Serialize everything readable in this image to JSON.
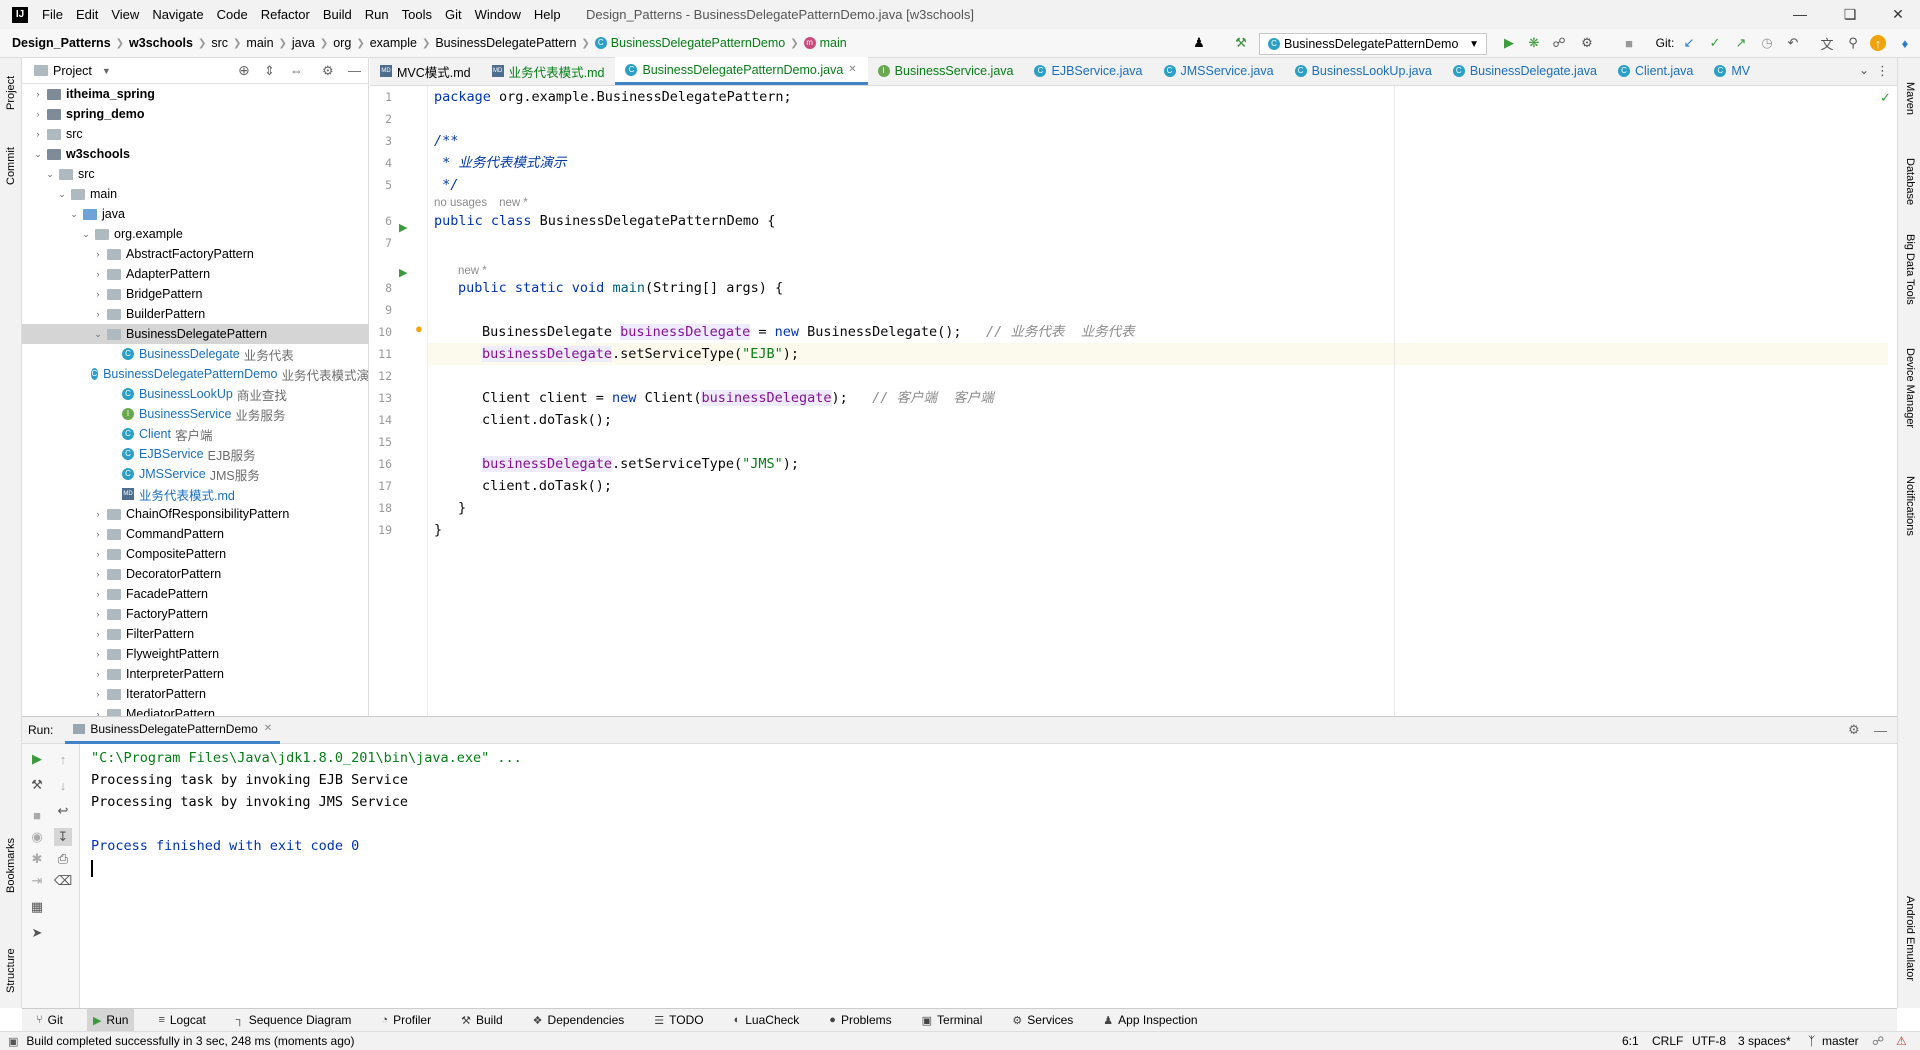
{
  "menubar": {
    "logo": "IJ",
    "items": [
      "File",
      "Edit",
      "View",
      "Navigate",
      "Code",
      "Refactor",
      "Build",
      "Run",
      "Tools",
      "Git",
      "Window",
      "Help"
    ],
    "window_title": "Design_Patterns - BusinessDelegatePatternDemo.java [w3schools]"
  },
  "breadcrumb": [
    "Design_Patterns",
    "w3schools",
    "src",
    "main",
    "java",
    "org",
    "example",
    "BusinessDelegatePattern",
    "BusinessDelegatePatternDemo",
    "main"
  ],
  "toolbar": {
    "run_config": "BusinessDelegatePatternDemo",
    "git_label": "Git:"
  },
  "project_panel": {
    "title": "Project",
    "tree": [
      {
        "label": "itheima_spring",
        "bold": true,
        "depth": 0,
        "arrow": "›",
        "icon": "folder-mod"
      },
      {
        "label": "spring_demo",
        "bold": true,
        "depth": 0,
        "arrow": "›",
        "icon": "folder-mod"
      },
      {
        "label": "src",
        "depth": 0,
        "arrow": "›",
        "icon": "folder"
      },
      {
        "label": "w3schools",
        "bold": true,
        "depth": 0,
        "arrow": "⌄",
        "icon": "folder-mod"
      },
      {
        "label": "src",
        "depth": 1,
        "arrow": "⌄",
        "icon": "folder"
      },
      {
        "label": "main",
        "depth": 2,
        "arrow": "⌄",
        "icon": "folder"
      },
      {
        "label": "java",
        "depth": 3,
        "arrow": "⌄",
        "icon": "folder-src"
      },
      {
        "label": "org.example",
        "depth": 4,
        "arrow": "⌄",
        "icon": "folder"
      },
      {
        "label": "AbstractFactoryPattern",
        "depth": 5,
        "arrow": "›",
        "icon": "folder"
      },
      {
        "label": "AdapterPattern",
        "depth": 5,
        "arrow": "›",
        "icon": "folder"
      },
      {
        "label": "BridgePattern",
        "depth": 5,
        "arrow": "›",
        "icon": "folder"
      },
      {
        "label": "BuilderPattern",
        "depth": 5,
        "arrow": "›",
        "icon": "folder"
      },
      {
        "label": "BusinessDelegatePattern",
        "depth": 5,
        "arrow": "⌄",
        "icon": "folder",
        "selected": true
      },
      {
        "label": "BusinessDelegate",
        "hint": "业务代表",
        "depth": 6,
        "icon": "class",
        "color": "blue"
      },
      {
        "label": "BusinessDelegatePatternDemo",
        "hint": "业务代表模式演",
        "depth": 6,
        "icon": "class",
        "color": "blue"
      },
      {
        "label": "BusinessLookUp",
        "hint": "商业查找",
        "depth": 6,
        "icon": "class",
        "color": "blue"
      },
      {
        "label": "BusinessService",
        "hint": "业务服务",
        "depth": 6,
        "icon": "interface",
        "color": "blue"
      },
      {
        "label": "Client",
        "hint": "客户端",
        "depth": 6,
        "icon": "class",
        "color": "blue"
      },
      {
        "label": "EJBService",
        "hint": "EJB服务",
        "depth": 6,
        "icon": "class",
        "color": "blue"
      },
      {
        "label": "JMSService",
        "hint": "JMS服务",
        "depth": 6,
        "icon": "class",
        "color": "blue"
      },
      {
        "label": "业务代表模式.md",
        "depth": 6,
        "icon": "md",
        "color": "blue"
      },
      {
        "label": "ChainOfResponsibilityPattern",
        "depth": 5,
        "arrow": "›",
        "icon": "folder"
      },
      {
        "label": "CommandPattern",
        "depth": 5,
        "arrow": "›",
        "icon": "folder"
      },
      {
        "label": "CompositePattern",
        "depth": 5,
        "arrow": "›",
        "icon": "folder"
      },
      {
        "label": "DecoratorPattern",
        "depth": 5,
        "arrow": "›",
        "icon": "folder"
      },
      {
        "label": "FacadePattern",
        "depth": 5,
        "arrow": "›",
        "icon": "folder"
      },
      {
        "label": "FactoryPattern",
        "depth": 5,
        "arrow": "›",
        "icon": "folder"
      },
      {
        "label": "FilterPattern",
        "depth": 5,
        "arrow": "›",
        "icon": "folder"
      },
      {
        "label": "FlyweightPattern",
        "depth": 5,
        "arrow": "›",
        "icon": "folder"
      },
      {
        "label": "InterpreterPattern",
        "depth": 5,
        "arrow": "›",
        "icon": "folder"
      },
      {
        "label": "IteratorPattern",
        "depth": 5,
        "arrow": "›",
        "icon": "folder"
      },
      {
        "label": "MediatorPattern",
        "depth": 5,
        "arrow": "›",
        "icon": "folder"
      }
    ]
  },
  "editor_tabs": [
    {
      "label": "MVC模式.md",
      "icon": "md"
    },
    {
      "label": "业务代表模式.md",
      "icon": "md",
      "color": "green"
    },
    {
      "label": "BusinessDelegatePatternDemo.java",
      "icon": "class",
      "active": true,
      "color": "green"
    },
    {
      "label": "BusinessService.java",
      "icon": "interface",
      "color": "green"
    },
    {
      "label": "EJBService.java",
      "icon": "class",
      "color": "blue"
    },
    {
      "label": "JMSService.java",
      "icon": "class",
      "color": "blue"
    },
    {
      "label": "BusinessLookUp.java",
      "icon": "class",
      "color": "blue"
    },
    {
      "label": "BusinessDelegate.java",
      "icon": "class",
      "color": "blue"
    },
    {
      "label": "Client.java",
      "icon": "class",
      "color": "blue"
    },
    {
      "label": "MV",
      "icon": "class",
      "color": "blue"
    }
  ],
  "code": {
    "line_numbers": [
      "1",
      "2",
      "3",
      "4",
      "5",
      "6",
      "7",
      "8",
      "9",
      "10",
      "11",
      "12",
      "13",
      "14",
      "15",
      "16",
      "17",
      "18",
      "19"
    ],
    "inlay": {
      "no_usages": "no usages",
      "new": "new *"
    },
    "package_kw": "package",
    "package_name": " org.example.BusinessDelegatePattern;",
    "doc_open": "/**",
    "doc_text": " * 业务代表模式演示",
    "doc_close": " */",
    "kw_public_class": "public class",
    "class_decl": " BusinessDelegatePatternDemo {",
    "kw_public_static_void": "public static void",
    "method_name": "main",
    "method_params": "(String[] args) {",
    "l10_type": "BusinessDelegate ",
    "l10_var": "businessDelegate",
    "l10_eq": " = ",
    "l10_new": "new",
    "l10_ctor": " BusinessDelegate();",
    "l10_cm": "// 业务代表  业务代表",
    "l11_var": "businessDelegate",
    "l11_call": ".setServiceType(",
    "l11_str": "\"EJB\"",
    "l11_end": ");",
    "l13_a": "Client client = ",
    "l13_new": "new",
    "l13_b": " Client(",
    "l13_var": "businessDelegate",
    "l13_c": ");",
    "l13_cm": "// 客户端  客户端",
    "l14": "client.doTask();",
    "l16_var": "businessDelegate",
    "l16_call": ".setServiceType(",
    "l16_str": "\"JMS\"",
    "l16_end": ");",
    "l17": "client.doTask();",
    "l18": "}",
    "l19": "}"
  },
  "run_panel": {
    "label": "Run:",
    "tab": "BusinessDelegatePatternDemo",
    "output": [
      "\"C:\\Program Files\\Java\\jdk1.8.0_201\\bin\\java.exe\" ...",
      "Processing task by invoking EJB Service",
      "Processing task by invoking JMS Service",
      "",
      "Process finished with exit code 0"
    ]
  },
  "tool_tabs": [
    {
      "label": "Git",
      "icon": "⑂"
    },
    {
      "label": "Run",
      "icon": "▶",
      "active": true
    },
    {
      "label": "Logcat",
      "icon": "≡"
    },
    {
      "label": "Sequence Diagram",
      "icon": "┐"
    },
    {
      "label": "Profiler",
      "icon": "◔"
    },
    {
      "label": "Build",
      "icon": "⚒"
    },
    {
      "label": "Dependencies",
      "icon": "❖"
    },
    {
      "label": "TODO",
      "icon": "☰"
    },
    {
      "label": "LuaCheck",
      "icon": "◐"
    },
    {
      "label": "Problems",
      "icon": "●"
    },
    {
      "label": "Terminal",
      "icon": "▣"
    },
    {
      "label": "Services",
      "icon": "⚙"
    },
    {
      "label": "App Inspection",
      "icon": "♟"
    }
  ],
  "left_stripe": [
    "Project",
    "Commit",
    "Bookmarks",
    "Structure"
  ],
  "right_stripe": [
    "Maven",
    "Database",
    "Big Data Tools",
    "Device Manager",
    "Notifications",
    "Android Emulator"
  ],
  "status": {
    "message": "Build completed successfully in 3 sec, 248 ms (moments ago)",
    "position": "6:1",
    "line_sep": "CRLF",
    "encoding": "UTF-8",
    "indent": "3 spaces*",
    "branch": "master"
  },
  "colors": {
    "accent": "#4083c9",
    "keyword": "#0033b3",
    "string": "#067d17",
    "field": "#871094",
    "comment": "#8c8c8c"
  }
}
